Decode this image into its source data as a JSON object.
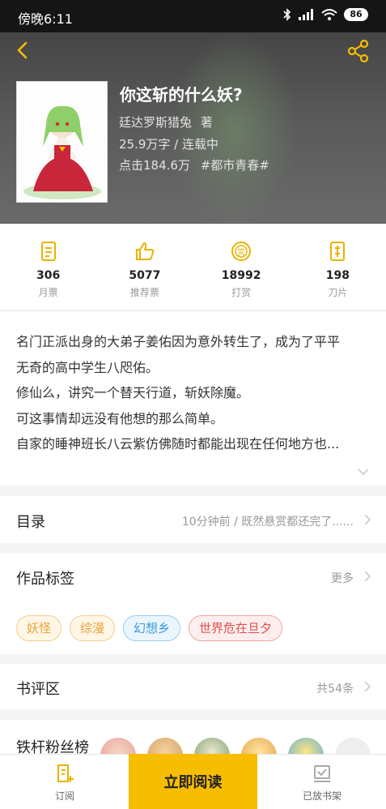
{
  "status_bar": {
    "time": "傍晚6:11",
    "battery": "86"
  },
  "book": {
    "title": "你这斩的什么妖?",
    "author": "廷达罗斯猎兔",
    "author_suffix": "著",
    "word_count_status": "25.9万字 / 连载中",
    "clicks": "点击184.6万",
    "category_tag": "#都市青春#"
  },
  "stats": [
    {
      "icon": "monthly-ticket-icon",
      "value": "306",
      "label": "月票"
    },
    {
      "icon": "thumbs-up-icon",
      "value": "5077",
      "label": "推荐票"
    },
    {
      "icon": "reward-coin-icon",
      "value": "18992",
      "label": "打赏"
    },
    {
      "icon": "blade-card-icon",
      "value": "198",
      "label": "刀片"
    }
  ],
  "description": [
    "名门正派出身的大弟子姜佑因为意外转生了，成为了平平",
    "无奇的高中学生八咫佑。",
    "修仙么，讲究一个替天行道，斩妖除魔。",
    "可这事情却远没有他想的那么简单。",
    "自家的睡神班长八云紫仿佛随时都能出现在任何地方也..."
  ],
  "toc": {
    "title": "目录",
    "latest": "10分钟前 / 既然悬赏都还完了......"
  },
  "work_tags": {
    "title": "作品标签",
    "more": "更多",
    "tags": [
      {
        "label": "妖怪",
        "color": "#e8a23a",
        "bg": "#fff6e6"
      },
      {
        "label": "综漫",
        "color": "#e8a23a",
        "bg": "#fff6e6"
      },
      {
        "label": "幻想乡",
        "color": "#3a9ad8",
        "bg": "#eaf5fd"
      },
      {
        "label": "世界危在旦夕",
        "color": "#e05050",
        "bg": "#fdeeee"
      }
    ]
  },
  "reviews": {
    "title": "书评区",
    "count": "共54条"
  },
  "fans": {
    "title": "铁杆粉丝榜"
  },
  "bottom": {
    "subscribe": "订阅",
    "read_now": "立即阅读",
    "on_shelf": "已放书架"
  },
  "colors": {
    "accent": "#f7bd00",
    "icon_accent": "#e9b200"
  }
}
